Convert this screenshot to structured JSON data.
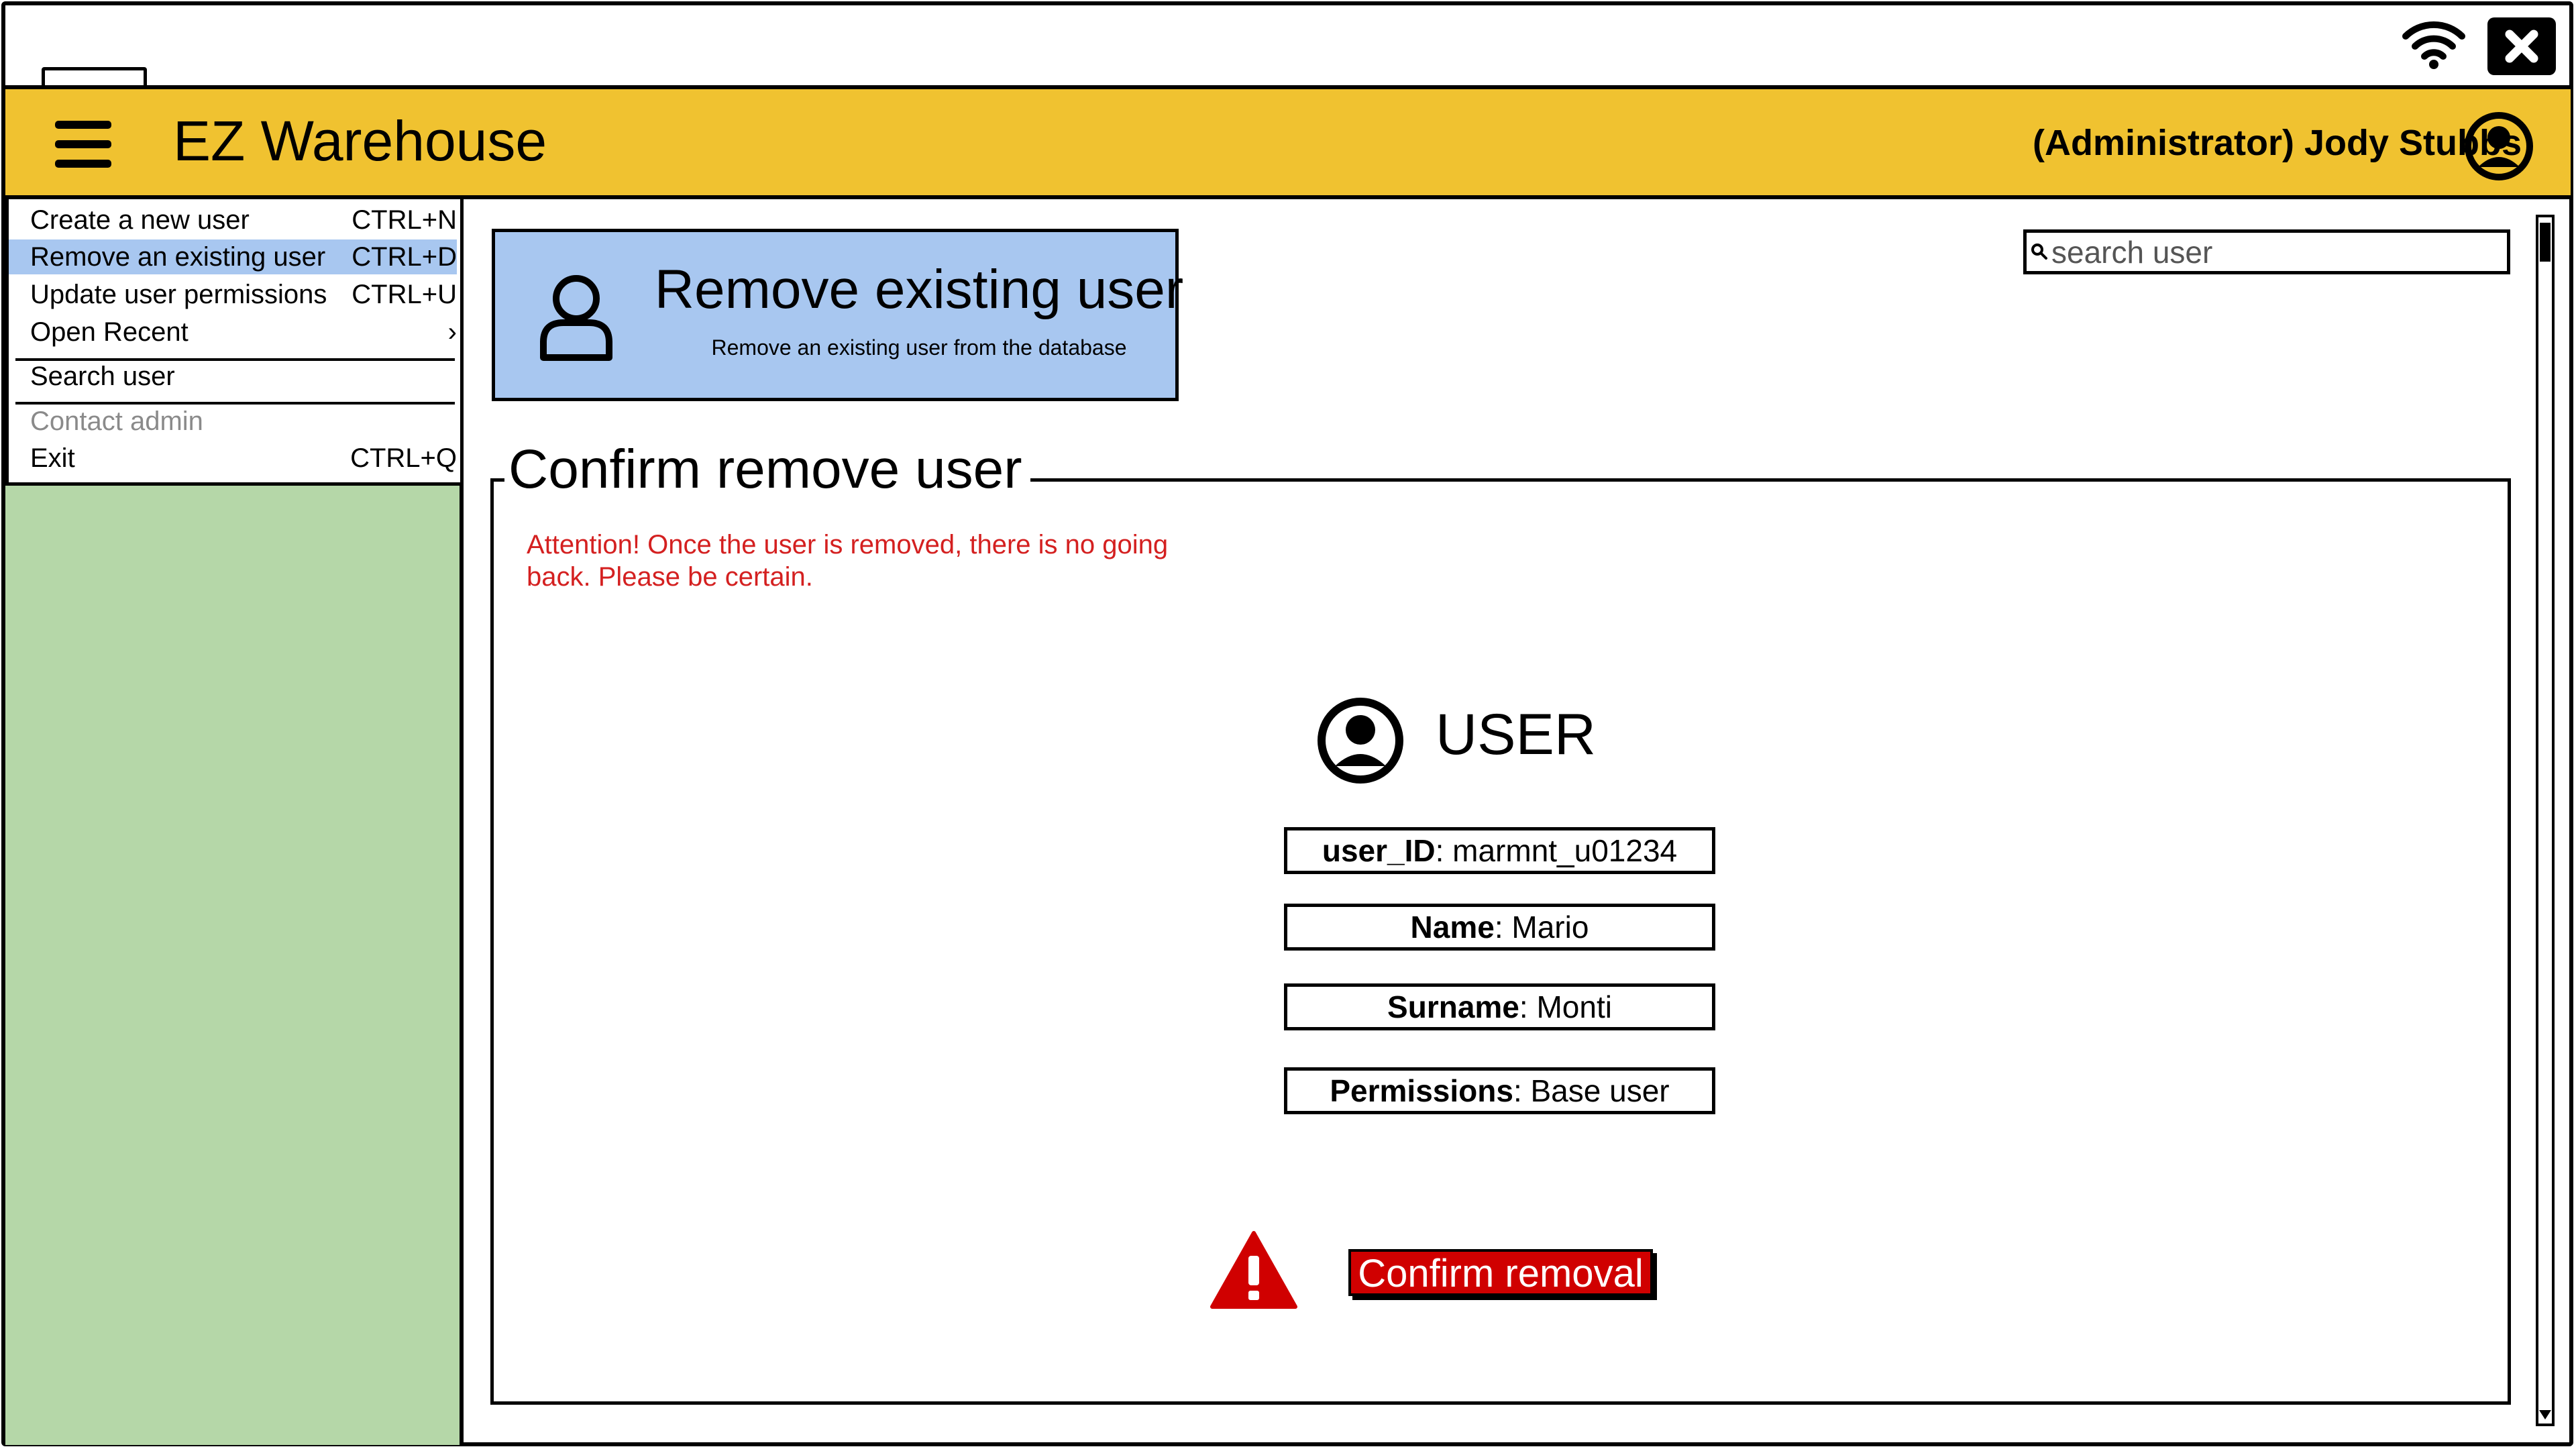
{
  "app": {
    "title": "EZ Warehouse",
    "user_label": "(Administrator) Jody Stubbs"
  },
  "menu": {
    "items": [
      {
        "label": "Create a new user",
        "shortcut": "CTRL+N",
        "state": "normal"
      },
      {
        "label": "Remove an existing user",
        "shortcut": "CTRL+D",
        "state": "selected"
      },
      {
        "label": "Update user permissions",
        "shortcut": "CTRL+U",
        "state": "normal"
      },
      {
        "label": "Open Recent",
        "shortcut": "›",
        "state": "normal"
      },
      {
        "label": "Search user",
        "shortcut": "",
        "state": "normal"
      },
      {
        "label": "Contact admin",
        "shortcut": "",
        "state": "disabled"
      },
      {
        "label": "Exit",
        "shortcut": "CTRL+Q",
        "state": "normal"
      }
    ]
  },
  "page": {
    "title": "Remove existing user",
    "subtitle": "Remove an existing user from the database"
  },
  "search": {
    "placeholder": "search user",
    "value": ""
  },
  "panel": {
    "legend": "Confirm remove user",
    "warning": "Attention! Once the user is removed, there is no going back. Please be certain.",
    "user_heading": "USER",
    "fields": [
      {
        "label": "user_ID",
        "value": ": marmnt_u01234"
      },
      {
        "label": "Name",
        "value": ": Mario"
      },
      {
        "label": "Surname",
        "value": ": Monti"
      },
      {
        "label": "Permissions",
        "value": ": Base user"
      }
    ],
    "confirm_label": "Confirm removal"
  },
  "colors": {
    "header": "#f0c230",
    "sidebar": "#b5d7a8",
    "selected": "#a8c7f0",
    "warning_text": "#d42020",
    "danger": "#d00000"
  },
  "icons": [
    "wifi-icon",
    "close-icon",
    "hamburger-menu-icon",
    "account-circle-icon",
    "user-outline-icon",
    "search-icon",
    "warning-triangle-icon"
  ]
}
